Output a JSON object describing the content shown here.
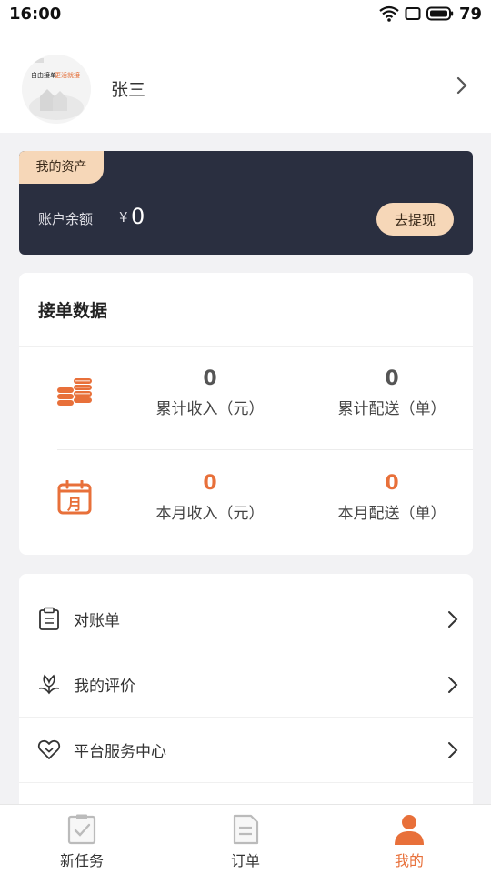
{
  "status_bar": {
    "time": "16:00",
    "battery": "79"
  },
  "profile": {
    "name": "张三",
    "avatar_text_small": "自由接单",
    "avatar_text_accent": "更活就接"
  },
  "assets": {
    "tag": "我的资产",
    "balance_label": "账户余额",
    "currency": "¥",
    "balance_value": "0",
    "withdraw_label": "去提现"
  },
  "orders": {
    "title": "接单数据",
    "total_income_value": "0",
    "total_income_label": "累计收入（元）",
    "total_delivery_value": "0",
    "total_delivery_label": "累计配送（单）",
    "month_income_value": "0",
    "month_income_label": "本月收入（元）",
    "month_delivery_value": "0",
    "month_delivery_label": "本月配送（单）",
    "calendar_icon_text": "月"
  },
  "menu": {
    "items": [
      {
        "label": "对账单"
      },
      {
        "label": "我的评价"
      },
      {
        "label": "平台服务中心"
      }
    ]
  },
  "tabbar": {
    "tabs": [
      {
        "label": "新任务"
      },
      {
        "label": "订单"
      },
      {
        "label": "我的"
      }
    ]
  },
  "colors": {
    "accent": "#e8703a",
    "dark_card": "#2a2f40",
    "gold": "#f6d7b8"
  }
}
